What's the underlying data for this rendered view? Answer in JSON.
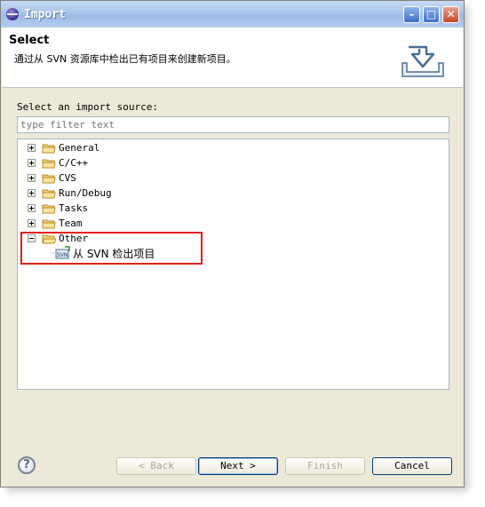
{
  "window": {
    "title": "Import"
  },
  "header": {
    "title": "Select",
    "description": "通过从 SVN 资源库中检出已有项目来创建新项目。"
  },
  "source_label": "Select an import source:",
  "filter": {
    "placeholder": "type filter text",
    "value": ""
  },
  "tree": {
    "items": [
      {
        "label": "General",
        "expanded": false
      },
      {
        "label": "C/C++",
        "expanded": false
      },
      {
        "label": "CVS",
        "expanded": false
      },
      {
        "label": "Run/Debug",
        "expanded": false
      },
      {
        "label": "Tasks",
        "expanded": false
      },
      {
        "label": "Team",
        "expanded": false
      },
      {
        "label": "Other",
        "expanded": true,
        "children": [
          {
            "label": "从 SVN 检出项目"
          }
        ]
      }
    ]
  },
  "buttons": {
    "back": "< Back",
    "next": "Next >",
    "finish": "Finish",
    "cancel": "Cancel"
  },
  "icons": {
    "app": "eclipse-icon",
    "minimize": "minimize-icon",
    "maximize": "maximize-icon",
    "close": "close-icon",
    "header_banner": "import-tray-icon",
    "folder": "folder-icon",
    "svn_checkout": "svn-checkout-icon",
    "help": "help-icon"
  },
  "colors": {
    "highlight_box": "#e0201e",
    "titlebar": "#aac5ea",
    "dialog_bg": "#ece9d8"
  }
}
